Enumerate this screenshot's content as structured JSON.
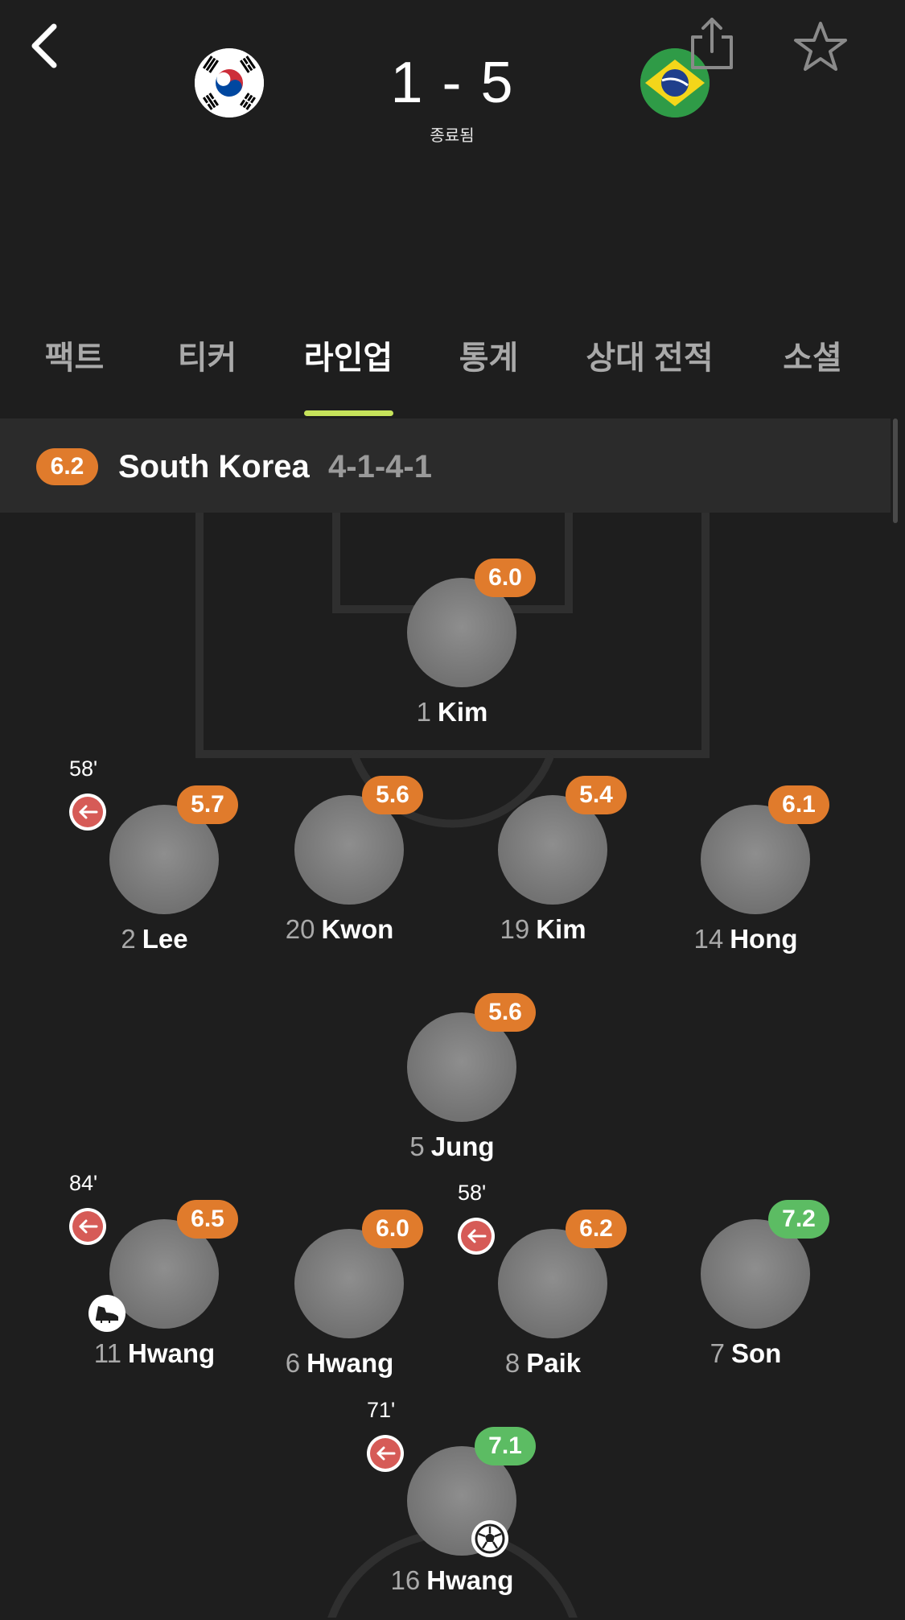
{
  "header": {
    "home_team_flag": "south-korea-flag",
    "away_team_flag": "brazil-flag",
    "score": "1 - 5",
    "status": "종료됨",
    "icons": {
      "back": "back-chevron-icon",
      "share": "share-icon",
      "favorite": "star-icon"
    }
  },
  "tabs": [
    {
      "label": "팩트",
      "active": false
    },
    {
      "label": "티커",
      "active": false
    },
    {
      "label": "라인업",
      "active": true
    },
    {
      "label": "통계",
      "active": false
    },
    {
      "label": "상대 전적",
      "active": false
    },
    {
      "label": "소셜",
      "active": false
    }
  ],
  "team": {
    "rating": "6.2",
    "name": "South Korea",
    "formation": "4-1-4-1"
  },
  "players": [
    {
      "number": "1",
      "name": "Kim",
      "rating": "6.0",
      "rating_color": "orange"
    },
    {
      "number": "2",
      "name": "Lee",
      "rating": "5.7",
      "rating_color": "orange",
      "sub_time": "58'"
    },
    {
      "number": "20",
      "name": "Kwon",
      "rating": "5.6",
      "rating_color": "orange"
    },
    {
      "number": "19",
      "name": "Kim",
      "rating": "5.4",
      "rating_color": "orange"
    },
    {
      "number": "14",
      "name": "Hong",
      "rating": "6.1",
      "rating_color": "orange"
    },
    {
      "number": "5",
      "name": "Jung",
      "rating": "5.6",
      "rating_color": "orange"
    },
    {
      "number": "11",
      "name": "Hwang",
      "rating": "6.5",
      "rating_color": "orange",
      "sub_time": "84'",
      "event": "boot-icon"
    },
    {
      "number": "6",
      "name": "Hwang",
      "rating": "6.0",
      "rating_color": "orange"
    },
    {
      "number": "8",
      "name": "Paik",
      "rating": "6.2",
      "rating_color": "orange",
      "sub_time": "58'"
    },
    {
      "number": "7",
      "name": "Son",
      "rating": "7.2",
      "rating_color": "green"
    },
    {
      "number": "16",
      "name": "Hwang",
      "rating": "7.1",
      "rating_color": "green",
      "sub_time": "71'",
      "event": "football-icon"
    }
  ],
  "colors": {
    "background": "#1e1e1e",
    "rating_orange": "#e07b2c",
    "rating_green": "#5cbc63",
    "tab_indicator": "#c7e35b",
    "sub_out_red": "#d65b57"
  }
}
